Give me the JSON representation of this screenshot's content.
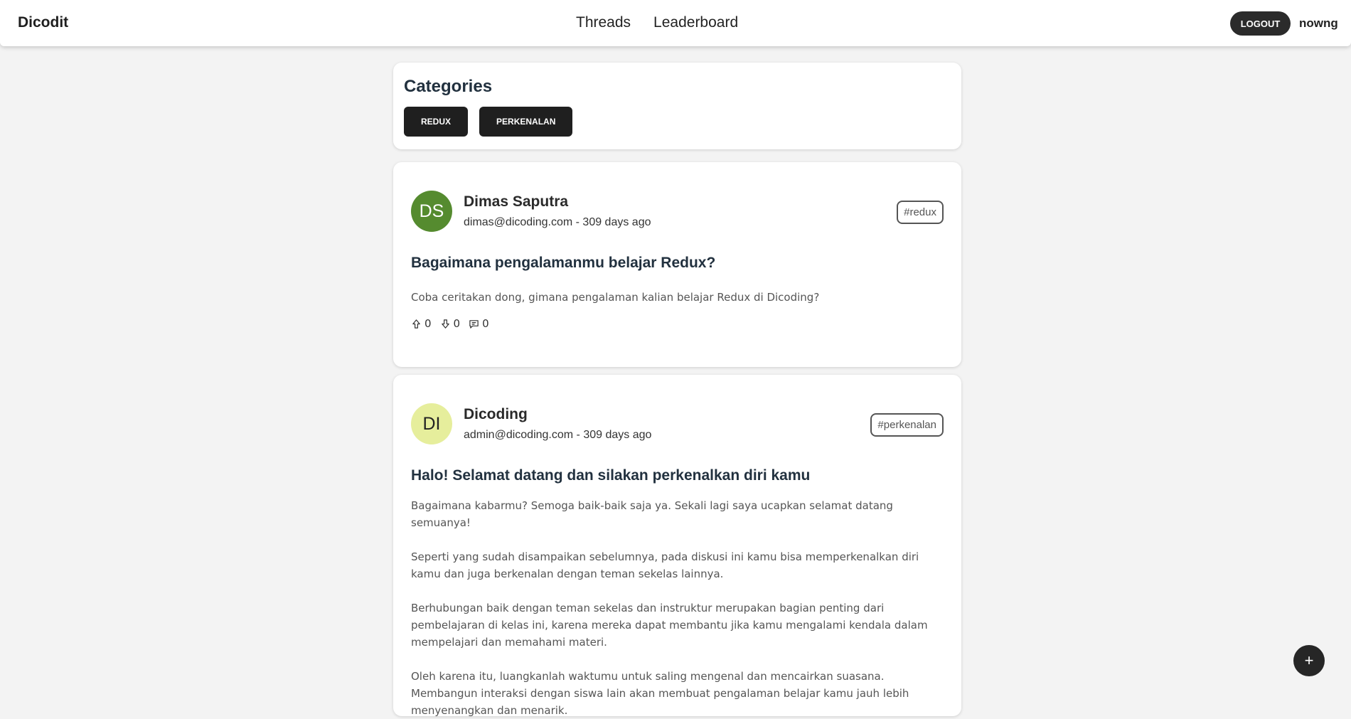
{
  "header": {
    "brand": "Dicodit",
    "nav": [
      "Threads",
      "Leaderboard"
    ],
    "logout_label": "LOGOUT",
    "username": "nowng"
  },
  "categories": {
    "title": "Categories",
    "items": [
      "REDUX",
      "PERKENALAN"
    ]
  },
  "threads": [
    {
      "avatar_initials": "DS",
      "avatar_color": "#558b2f",
      "avatar_text_color": "#ffffff",
      "owner_name": "Dimas Saputra",
      "meta": "dimas@dicoding.com - 309 days ago",
      "tag": "#redux",
      "title": "Bagaimana pengalamanmu belajar Redux?",
      "paragraphs": [
        "Coba ceritakan dong, gimana pengalaman kalian belajar Redux di Dicoding?"
      ],
      "upvotes": "0",
      "downvotes": "0",
      "comments": "0"
    },
    {
      "avatar_initials": "DI",
      "avatar_color": "#e6ee9c",
      "avatar_text_color": "#222222",
      "owner_name": "Dicoding",
      "meta": "admin@dicoding.com - 309 days ago",
      "tag": "#perkenalan",
      "title": "Halo! Selamat datang dan silakan perkenalkan diri kamu",
      "paragraphs": [
        "Bagaimana kabarmu? Semoga baik-baik saja ya. Sekali lagi saya ucapkan selamat datang semuanya!",
        "Seperti yang sudah disampaikan sebelumnya, pada diskusi ini kamu bisa memperkenalkan diri kamu dan juga berkenalan dengan teman sekelas lainnya.",
        "Berhubungan baik dengan teman sekelas dan instruktur merupakan bagian penting dari pembelajaran di kelas ini, karena mereka dapat membantu jika kamu mengalami kendala dalam mempelajari dan memahami materi.",
        "Oleh karena itu, luangkanlah waktumu untuk saling mengenal dan mencairkan suasana. Membangun interaksi dengan siswa lain akan membuat pengalaman belajar kamu jauh lebih menyenangkan dan menarik."
      ]
    }
  ],
  "fab_label": "+"
}
